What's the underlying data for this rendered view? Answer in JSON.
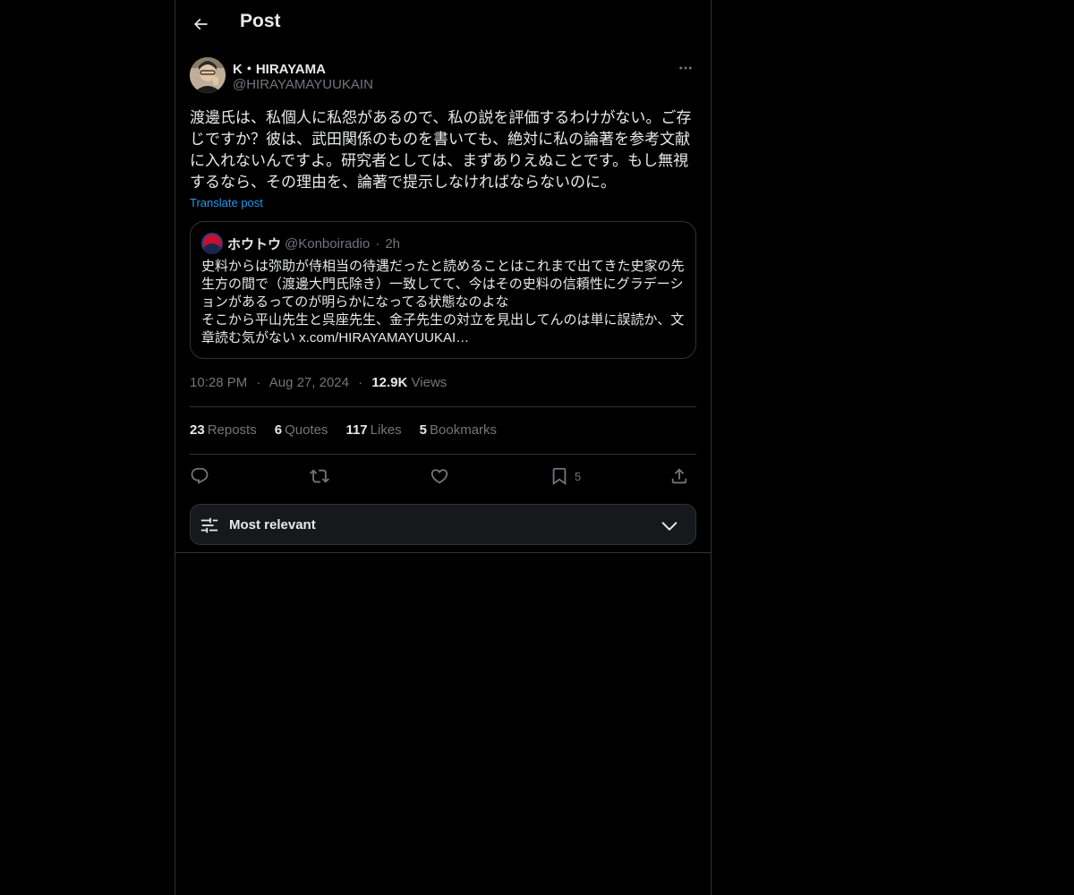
{
  "header": {
    "title": "Post"
  },
  "post": {
    "author": {
      "display_name": "K・HIRAYAMA",
      "handle": "@HIRAYAMAYUUKAIN"
    },
    "text": "渡邊氏は、私個人に私怨があるので、私の説を評価するわけがない。ご存じですか？彼は、武田関係のものを書いても、絶対に私の論著を参考文献に入れないんですよ。研究者としては、まずありえぬことです。もし無視するなら、その理由を、論著で提示しなければならないのに。",
    "translate_label": "Translate post",
    "time": "10:28 PM",
    "date": "Aug 27, 2024",
    "views_count": "12.9K",
    "views_label": "Views",
    "meta_sep": "·"
  },
  "quote": {
    "name": "ホウトウ",
    "handle": "@Konboiradio",
    "sep": "·",
    "time": "2h",
    "lines": [
      "史料からは弥助が侍相当の待遇だったと読めることはこれまで出てきた史家の先生方の間で（渡邊大門氏除き）一致してて、今はその史料の信頼性にグラデーションがあるってのが明らかになってる状態なのよな",
      "そこから平山先生と呉座先生、金子先生の対立を見出してんのは単に誤読か、文章読む気がない x.com/HIRAYAMAYUUKAI…"
    ]
  },
  "stats": {
    "reposts": {
      "count": "23",
      "label": "Reposts"
    },
    "quotes": {
      "count": "6",
      "label": "Quotes"
    },
    "likes": {
      "count": "117",
      "label": "Likes"
    },
    "bookmarks": {
      "count": "5",
      "label": "Bookmarks"
    }
  },
  "actions": {
    "reply": "reply-icon",
    "repost": "repost-icon",
    "like": "heart-icon",
    "bookmark": "bookmark-icon",
    "bookmark_count": "5",
    "share": "share-icon"
  },
  "sort": {
    "label": "Most relevant"
  },
  "colors": {
    "accent": "#1d9bf0",
    "background": "#000000",
    "border": "#2f3336",
    "muted": "#71767b",
    "text": "#e7e9ea"
  }
}
